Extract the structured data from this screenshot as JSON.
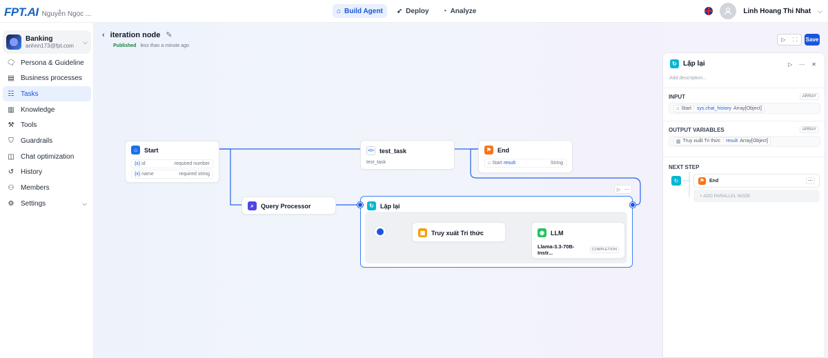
{
  "app": {
    "logo_text": "FPT.AI",
    "logo_subtitle": "Nguyễn Ngọc ...",
    "nav": [
      {
        "label": "Build Agent",
        "active": true
      },
      {
        "label": "Deploy",
        "active": false
      },
      {
        "label": "Analyze",
        "active": false
      }
    ],
    "user_name": "Linh Hoang Thi Nhat"
  },
  "workspace": {
    "name": "Banking",
    "email": "anhnn173@fpt.com"
  },
  "sidebar": {
    "items": [
      {
        "label": "Persona & Guideline",
        "icon": "chat-icon"
      },
      {
        "label": "Business processes",
        "icon": "document-icon"
      },
      {
        "label": "Tasks",
        "icon": "tasks-icon",
        "active": true
      },
      {
        "label": "Knowledge",
        "icon": "book-icon"
      },
      {
        "label": "Tools",
        "icon": "wrench-icon"
      },
      {
        "label": "Guardrails",
        "icon": "shield-icon"
      },
      {
        "label": "Chat optimization",
        "icon": "optimize-icon"
      },
      {
        "label": "History",
        "icon": "history-icon"
      },
      {
        "label": "Members",
        "icon": "members-icon"
      },
      {
        "label": "Settings",
        "icon": "gear-icon"
      }
    ]
  },
  "canvas": {
    "title": "iteration node",
    "status": "Published",
    "updated": "less than a minute ago",
    "save_label": "Save",
    "nodes": {
      "start": {
        "title": "Start",
        "vars": [
          {
            "name": "id",
            "req": "required number"
          },
          {
            "name": "name",
            "req": "required string"
          }
        ]
      },
      "test_task": {
        "title": "test_task",
        "sub": "test_task"
      },
      "end": {
        "title": "End",
        "row_label": "Start",
        "row_var": "result",
        "row_type": "String"
      },
      "query": {
        "title": "Query Processor"
      },
      "loop": {
        "title": "Lặp lại"
      },
      "retrieve": {
        "title": "Truy xuất Tri thức"
      },
      "llm": {
        "title": "LLM",
        "model": "Llama-3.3-70B-Instr...",
        "tag": "COMPLETION"
      }
    }
  },
  "panel": {
    "title": "Lặp lại",
    "description_placeholder": "Add description...",
    "input_label": "INPUT",
    "input_tag": "ARRAY",
    "input_source": "Start",
    "input_var": "sys.chat_history",
    "input_type": "Array[Object]",
    "output_label": "OUTPUT VARIABLES",
    "output_tag": "ARRAY",
    "output_source": "Truy xuất Tri thức",
    "output_var": "result",
    "output_type": "Array[Object]",
    "next_label": "NEXT STEP",
    "next_node": "End",
    "add_parallel": "+ ADD PARALLEL NODE"
  }
}
